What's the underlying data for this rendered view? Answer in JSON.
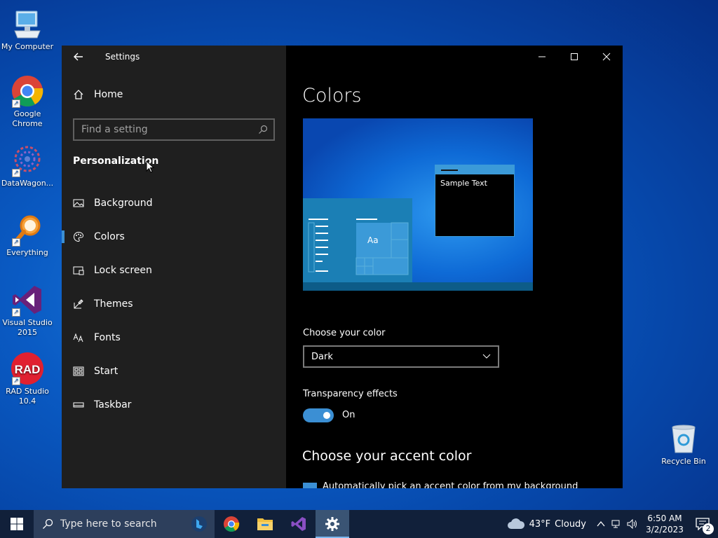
{
  "desktop": {
    "icons": [
      {
        "label": "My Computer"
      },
      {
        "label": "Google Chrome"
      },
      {
        "label": "DataWagon..."
      },
      {
        "label": "Everything"
      },
      {
        "label": "Visual Studio 2015"
      },
      {
        "label": "RAD Studio 10.4"
      },
      {
        "label": "Recycle Bin"
      }
    ],
    "rad_logo_text": "RAD"
  },
  "window": {
    "title": "Settings",
    "controls": {
      "minimize": "minimize",
      "maximize": "maximize",
      "close": "close"
    }
  },
  "sidebar": {
    "home_label": "Home",
    "search_placeholder": "Find a setting",
    "section_heading": "Personalization",
    "items": [
      {
        "label": "Background",
        "icon": "picture-icon"
      },
      {
        "label": "Colors",
        "icon": "palette-icon",
        "selected": true
      },
      {
        "label": "Lock screen",
        "icon": "lock-screen-icon"
      },
      {
        "label": "Themes",
        "icon": "brush-icon"
      },
      {
        "label": "Fonts",
        "icon": "font-icon"
      },
      {
        "label": "Start",
        "icon": "start-icon"
      },
      {
        "label": "Taskbar",
        "icon": "taskbar-icon"
      }
    ]
  },
  "main": {
    "title": "Colors",
    "preview": {
      "sample_text": "Sample Text",
      "tile_text": "Aa"
    },
    "choose_color_label": "Choose your color",
    "choose_color_value": "Dark",
    "transparency_label": "Transparency effects",
    "transparency_state": "On",
    "accent_heading": "Choose your accent color",
    "accent_auto_text": "Automatically pick an accent color from my background"
  },
  "taskbar": {
    "search_placeholder": "Type here to search",
    "weather": {
      "temp": "43°F",
      "condition": "Cloudy"
    },
    "clock": {
      "time": "6:50 AM",
      "date": "3/2/2023"
    },
    "notification_count": "2"
  },
  "colors": {
    "accent": "#3b8fd4",
    "sidebar_bg": "#1f1f1f",
    "taskbar_bg": "#11203a"
  }
}
